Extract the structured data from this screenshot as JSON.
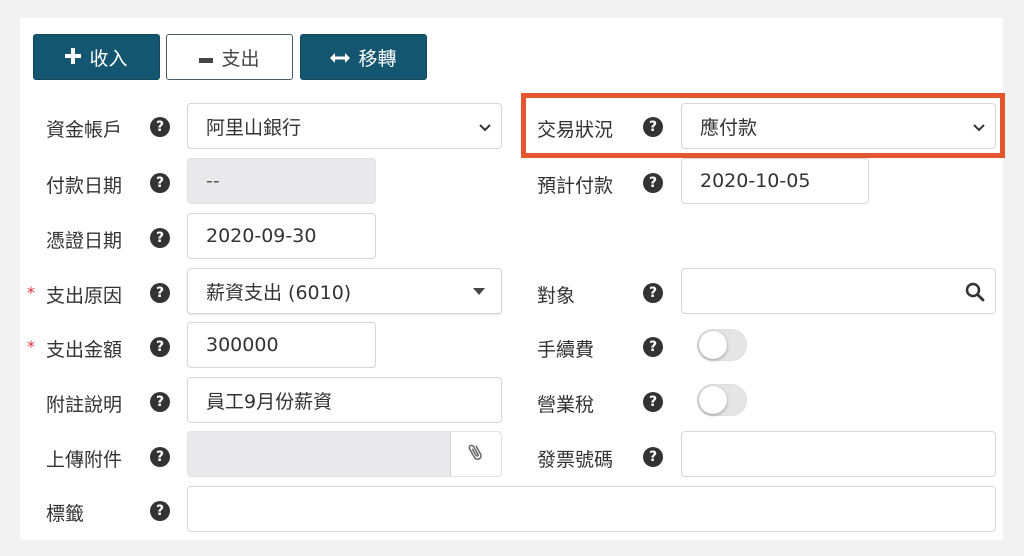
{
  "toolbar": {
    "income_label": "收入",
    "income_icon": "plus-icon",
    "expense_label": "支出",
    "expense_icon": "minus-icon",
    "transfer_label": "移轉",
    "transfer_icon": "left-right-arrow-icon"
  },
  "form": {
    "account": {
      "label": "資金帳戶",
      "value": "阿里山銀行"
    },
    "status": {
      "label": "交易狀況",
      "value": "應付款"
    },
    "pay_date": {
      "label": "付款日期",
      "value": "--"
    },
    "expected_pay_date": {
      "label": "預計付款",
      "value": "2020-10-05"
    },
    "voucher_date": {
      "label": "憑證日期",
      "value": "2020-09-30"
    },
    "reason": {
      "label": "支出原因",
      "required_mark": "*",
      "value": "薪資支出 (6010)"
    },
    "target": {
      "label": "對象",
      "value": ""
    },
    "amount": {
      "label": "支出金額",
      "required_mark": "*",
      "value": "300000"
    },
    "fee": {
      "label": "手續費",
      "on": false
    },
    "note": {
      "label": "附註說明",
      "value": "員工9月份薪資"
    },
    "business_tax": {
      "label": "營業稅",
      "on": false
    },
    "attachment": {
      "label": "上傳附件",
      "value": ""
    },
    "invoice_no": {
      "label": "發票號碼",
      "value": ""
    },
    "tags": {
      "label": "標籤",
      "value": ""
    },
    "help_glyph": "?"
  },
  "colors": {
    "primary": "#145670",
    "highlight": "#e4572e",
    "required": "#d9363e"
  }
}
